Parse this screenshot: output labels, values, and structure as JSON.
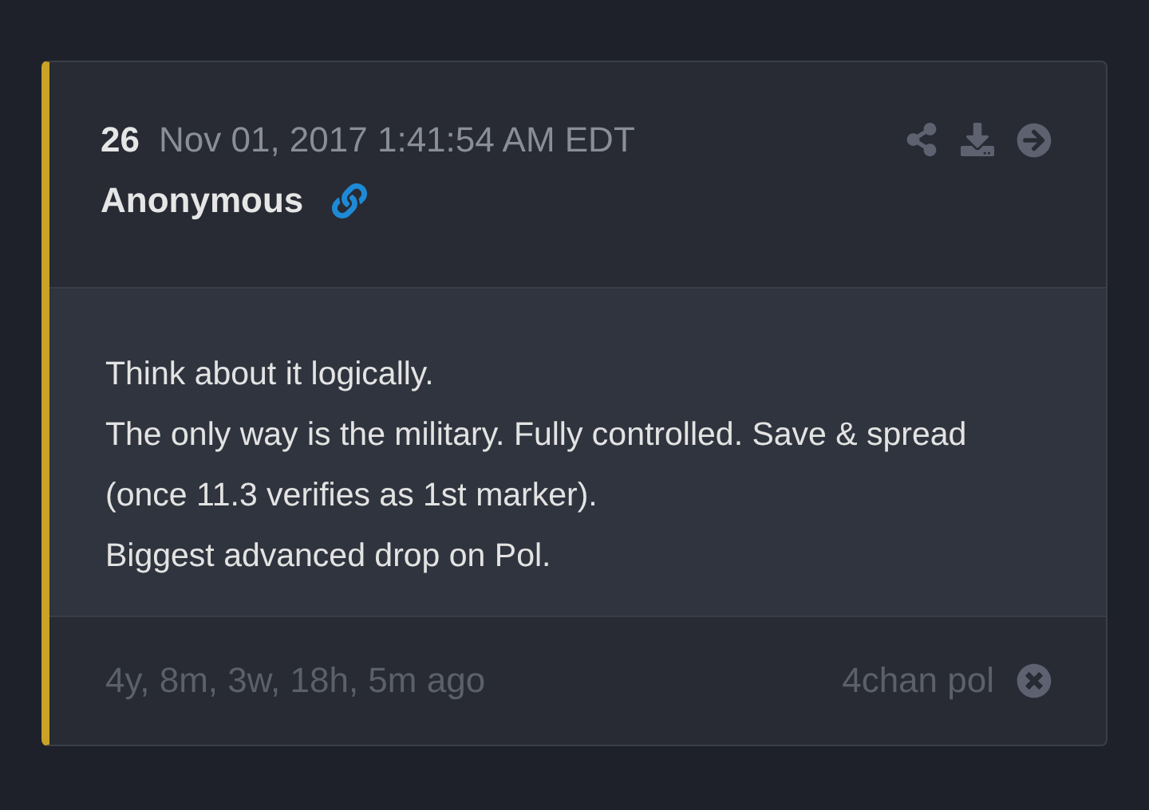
{
  "post": {
    "number": "26",
    "timestamp": "Nov 01, 2017 1:41:54 AM EDT",
    "author": "Anonymous",
    "body": [
      "Think about it logically.",
      "The only way is the military. Fully controlled. Save & spread (once 11.3 verifies as 1st marker).",
      "Biggest advanced drop on Pol."
    ],
    "age": "4y, 8m, 3w, 18h, 5m ago",
    "source": "4chan pol"
  }
}
